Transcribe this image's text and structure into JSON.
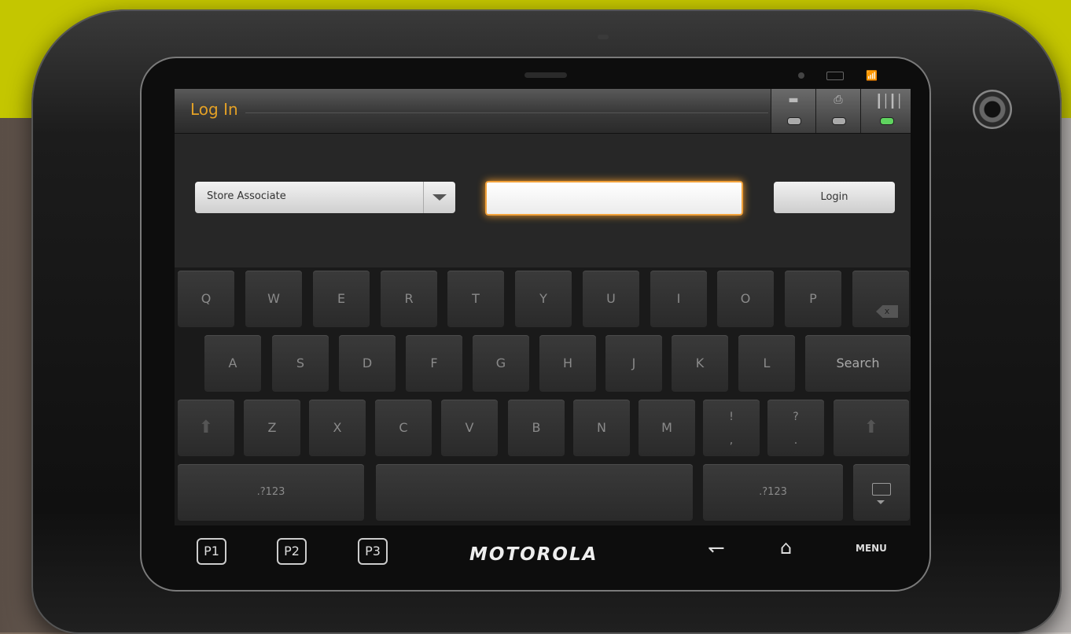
{
  "window": {
    "title": "Log In"
  },
  "peripherals": [
    {
      "name": "card-reader",
      "led": "off"
    },
    {
      "name": "printer",
      "led": "off"
    },
    {
      "name": "barcode-scanner",
      "led": "on"
    }
  ],
  "login_form": {
    "role_select_value": "Store Associate",
    "pin_value": "",
    "login_label": "Login"
  },
  "keyboard": {
    "row1": [
      "Q",
      "W",
      "E",
      "R",
      "T",
      "Y",
      "U",
      "I",
      "O",
      "P"
    ],
    "row2": [
      "A",
      "S",
      "D",
      "F",
      "G",
      "H",
      "J",
      "K",
      "L"
    ],
    "search_label": "Search",
    "row3": [
      "Z",
      "X",
      "C",
      "V",
      "B",
      "N",
      "M"
    ],
    "punct1": {
      "top": "!",
      "bottom": ","
    },
    "punct2": {
      "top": "?",
      "bottom": "."
    },
    "symbols_label": ".?123"
  },
  "hardware": {
    "p1": "P1",
    "p2": "P2",
    "p3": "P3",
    "brand": "MOTOROLA",
    "menu": "MENU"
  },
  "colors": {
    "accent_orange": "#e4a126",
    "led_on": "#5fd35f",
    "top_band": "#c4c600"
  }
}
